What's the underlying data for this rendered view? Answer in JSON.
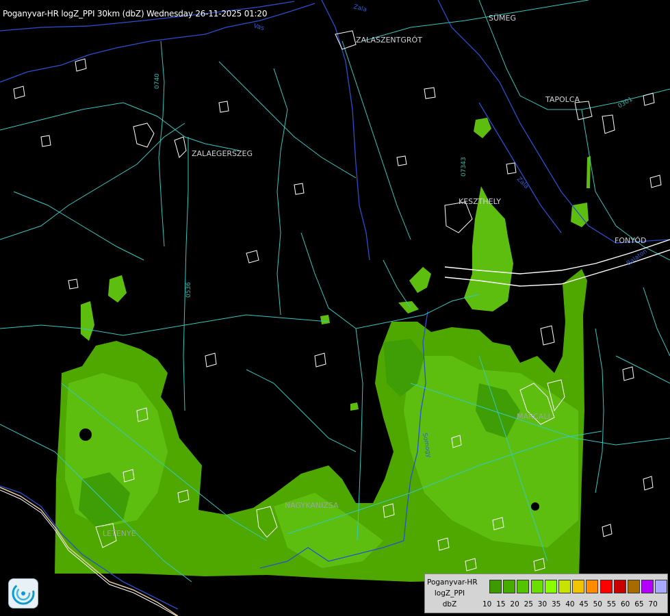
{
  "header": {
    "title": "Poganyvar-HR logZ_PPI 30km (dbZ) Wednesday 26-11-2025 01:20"
  },
  "places": [
    "SÜMEG",
    "ZALASZENTGRÓT",
    "TAPOLCA",
    "ZALAEGERSZEG",
    "KESZTHELY",
    "FONYÓD",
    "MARCALI",
    "NAGYKANIZSA",
    "LETENYE"
  ],
  "roads": [
    "0740",
    "0536",
    "07343",
    "0301"
  ],
  "rivers": [
    "Vas",
    "Zala",
    "Somogy",
    "Balaton",
    "Zala"
  ],
  "legend": {
    "line1": "Poganyvar-HR",
    "line2": "logZ_PPI",
    "line3": "dbZ",
    "ticks": [
      "10",
      "15",
      "20",
      "25",
      "30",
      "35",
      "40",
      "45",
      "50",
      "55",
      "60",
      "65",
      "70"
    ],
    "colors": [
      "#3d9a00",
      "#46ad00",
      "#55c400",
      "#6be000",
      "#8aff00",
      "#c8e300",
      "#f0c400",
      "#ff8b00",
      "#ff0000",
      "#c80000",
      "#a86b00",
      "#b400ff",
      "#a8a8ff"
    ]
  },
  "colors": {
    "echo_dark": "#3f9e06",
    "echo_mid": "#4ea800",
    "echo_light": "#5dbe10",
    "road": "#33c9c0",
    "river": "#2a4fd0",
    "border": "#ffffff"
  }
}
